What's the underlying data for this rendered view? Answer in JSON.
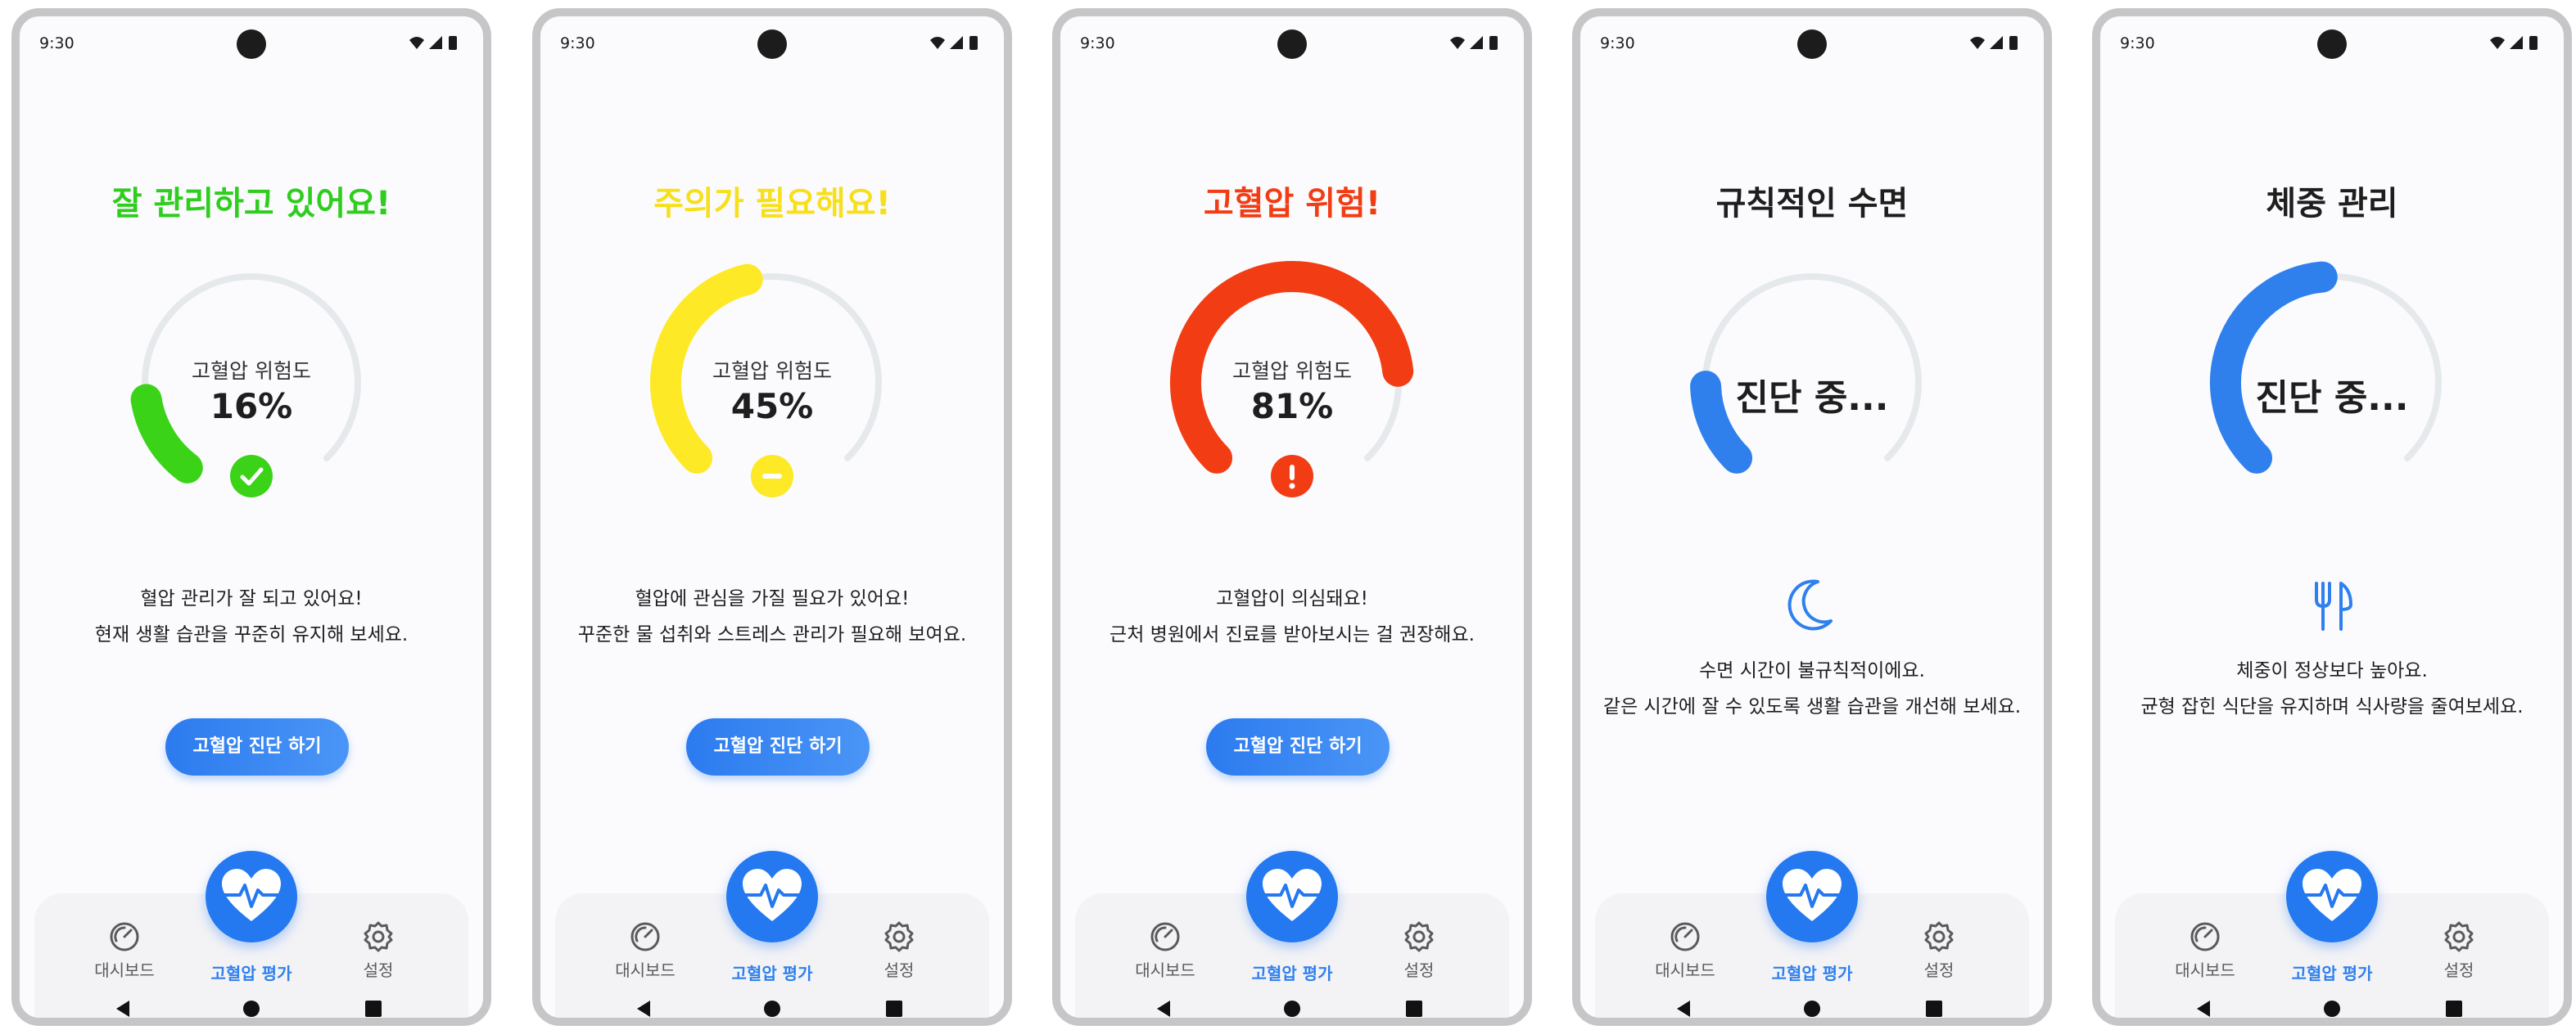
{
  "status_bar": {
    "time": "9:30"
  },
  "screens": [
    {
      "title": "잘 관리하고 있어요!",
      "title_color": "#2fcd1e",
      "gauge": {
        "label": "고혈압 위험도",
        "value_text": "16%",
        "fraction": 0.16,
        "color": "#3bd318",
        "status": "check-icon",
        "diagnosing": false
      },
      "message": [
        "혈압 관리가 잘 되고 있어요!",
        "현재 생활 습관을 꾸준히 유지해 보세요."
      ],
      "cta_label": "고혈압 진단 하기"
    },
    {
      "title": "주의가 필요해요!",
      "title_color": "#f8df1c",
      "gauge": {
        "label": "고혈압 위험도",
        "value_text": "45%",
        "fraction": 0.45,
        "color": "#fde925",
        "status": "minus-icon",
        "diagnosing": false
      },
      "message": [
        "혈압에 관심을 가질 필요가 있어요!",
        "꾸준한 물 섭취와 스트레스 관리가 필요해 보여요."
      ],
      "cta_label": "고혈압 진단 하기"
    },
    {
      "title": "고혈압 위험!",
      "title_color": "#f23d14",
      "gauge": {
        "label": "고혈압 위험도",
        "value_text": "81%",
        "fraction": 0.81,
        "color": "#f23d14",
        "status": "exclamation-icon",
        "diagnosing": false
      },
      "message": [
        "고혈압이 의심돼요!",
        "근처 병원에서 진료를 받아보시는 걸 권장해요."
      ],
      "cta_label": "고혈압 진단 하기"
    },
    {
      "title": "규칙적인 수면",
      "title_color": "#1e1e1e",
      "gauge": {
        "label": "",
        "value_text": "진단 중...",
        "fraction": 0.16,
        "color": "#2f80ed",
        "status": "",
        "diagnosing": true
      },
      "tip_icon": "moon-icon",
      "message": [
        "수면 시간이 불규칙적이에요.",
        "같은 시간에 잘 수 있도록 생활 습관을 개선해 보세요."
      ]
    },
    {
      "title": "체중 관리",
      "title_color": "#1e1e1e",
      "gauge": {
        "label": "",
        "value_text": "진단 중...",
        "fraction": 0.48,
        "color": "#2f80ed",
        "status": "",
        "diagnosing": true
      },
      "tip_icon": "fork-knife-icon",
      "message": [
        "체중이 정상보다 높아요.",
        "균형 잡힌 식단을 유지하며 식사량을 줄여보세요."
      ]
    }
  ],
  "nav": {
    "dashboard": "대시보드",
    "assessment": "고혈압 평가",
    "settings": "설정"
  },
  "colors": {
    "accent": "#2f80ed",
    "track": "#e5e9ec"
  }
}
